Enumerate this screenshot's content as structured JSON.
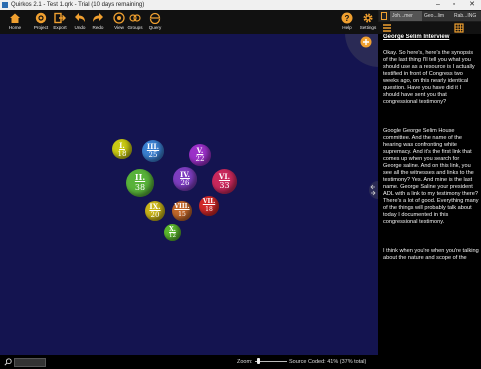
{
  "window": {
    "title": "Quirkos 2.1 - Test 1.qrk - Trial (10 days remaining)"
  },
  "toolbar": {
    "buttons": [
      {
        "name": "home-button",
        "icon": "home-icon",
        "label": "Home"
      },
      {
        "name": "project-button",
        "icon": "info-icon",
        "label": "Project"
      },
      {
        "name": "export-button",
        "icon": "export-icon",
        "label": "Export"
      },
      {
        "name": "undo-button",
        "icon": "undo-icon",
        "label": "Undo"
      },
      {
        "name": "redo-button",
        "icon": "redo-icon",
        "label": "Redo"
      },
      {
        "name": "view-button",
        "icon": "view-icon",
        "label": "View"
      },
      {
        "name": "groups-button",
        "icon": "groups-icon",
        "label": "Groups"
      },
      {
        "name": "query-button",
        "icon": "query-icon",
        "label": "Query"
      }
    ],
    "right_buttons": [
      {
        "name": "help-button",
        "icon": "help-icon",
        "label": "Help"
      },
      {
        "name": "settings-button",
        "icon": "settings-icon",
        "label": "Settings"
      }
    ]
  },
  "tabs": [
    "Joh...mer",
    "Geo...lim",
    "Rab...ING"
  ],
  "bubbles": [
    {
      "numeral": "I.",
      "count": "18",
      "color": "#c9c914"
    },
    {
      "numeral": "III.",
      "count": "25",
      "color": "#3a7fd0"
    },
    {
      "numeral": "V.",
      "count": "22",
      "color": "#9b30c8"
    },
    {
      "numeral": "II.",
      "count": "38",
      "color": "#58b23a"
    },
    {
      "numeral": "IV.",
      "count": "26",
      "color": "#7d3dbf"
    },
    {
      "numeral": "VI.",
      "count": "33",
      "color": "#c8285c"
    },
    {
      "numeral": "VII.",
      "count": "18",
      "color": "#d02828"
    },
    {
      "numeral": "IX.",
      "count": "20",
      "color": "#c9b419"
    },
    {
      "numeral": "VIII.",
      "count": "15",
      "color": "#c0662a"
    },
    {
      "numeral": "X.",
      "count": "12",
      "color": "#5cb82e"
    }
  ],
  "bottom": {
    "zoom_label": "Zoom:",
    "source_coded": "Source Coded: 41% (37% total)"
  },
  "panel": {
    "title": "George Selim Interview",
    "paragraphs": [
      "Okay. So here's, here's the synopsis of the last thing I'll tell you what you should use as a resource is I actually testified in front of Congress two weeks ago, on this nearly identical question. Have you have did it I should have sent you that congressional testimony?",
      "Google George Selim House committee. And the name of the hearing was confronting white supremacy. And it's the first link that comes up when you search for George saline. And on this link, you see all the witnesses and links to the testimony? Yes. And mine is the last name. George Saline your president ADL with a link to my testimony there? There's a lot of good. Everything many of the things will probably talk about today I documented in this congressional testimony.",
      "I think when you're when you're talking about the nature and scope of the"
    ]
  }
}
